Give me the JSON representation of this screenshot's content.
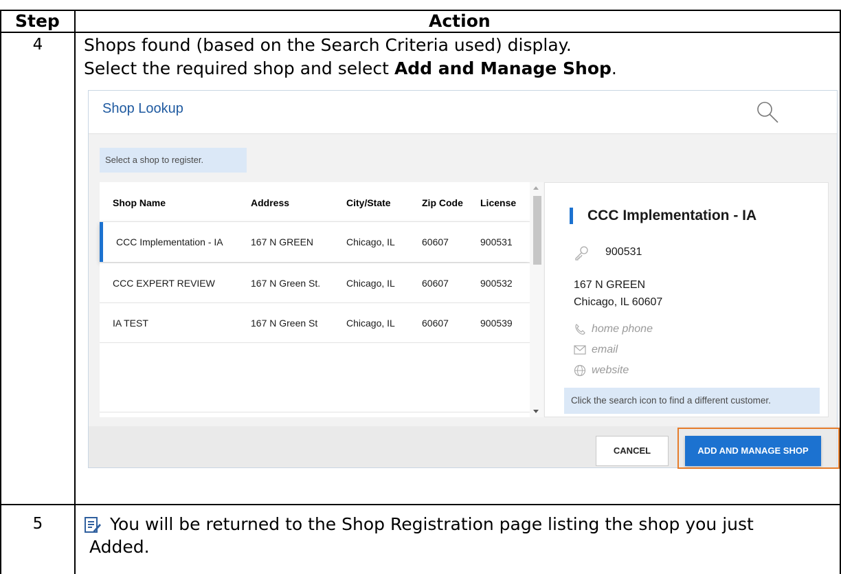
{
  "table": {
    "headers": {
      "step": "Step",
      "action": "Action"
    },
    "rows": [
      {
        "step": "4",
        "line1": "Shops found (based on the Search Criteria used) display.",
        "line2_prefix": "Select the required shop and select ",
        "line2_bold": "Add and Manage Shop",
        "line2_suffix": "."
      },
      {
        "step": "5",
        "line1": "You will be returned to the Shop Registration page listing the shop you just",
        "line2": "Added."
      }
    ]
  },
  "screenshot": {
    "title": "Shop Lookup",
    "hint": "Select a shop to register.",
    "columns": [
      "Shop Name",
      "Address",
      "City/State",
      "Zip Code",
      "License"
    ],
    "rows": [
      {
        "name": "CCC Implementation - IA",
        "address": "167 N GREEN",
        "city": "Chicago, IL",
        "zip": "60607",
        "license": "900531",
        "selected": true
      },
      {
        "name": "CCC EXPERT REVIEW",
        "address": "167 N Green St.",
        "city": "Chicago, IL",
        "zip": "60607",
        "license": "900532",
        "selected": false
      },
      {
        "name": "IA TEST",
        "address": "167 N Green St",
        "city": "Chicago, IL",
        "zip": "60607",
        "license": "900539",
        "selected": false
      }
    ],
    "detail": {
      "title": "CCC Implementation - IA",
      "license": "900531",
      "address_line1": "167 N GREEN",
      "address_line2": "Chicago, IL 60607",
      "phone": "home phone",
      "email": "email",
      "website": "website",
      "hint": "Click the search icon to find a different customer."
    },
    "buttons": {
      "cancel": "CANCEL",
      "add": "ADD AND MANAGE SHOP"
    },
    "colors": {
      "accent": "#1c72d0",
      "highlight": "#e67c2a",
      "title": "#1f5aa0"
    }
  }
}
